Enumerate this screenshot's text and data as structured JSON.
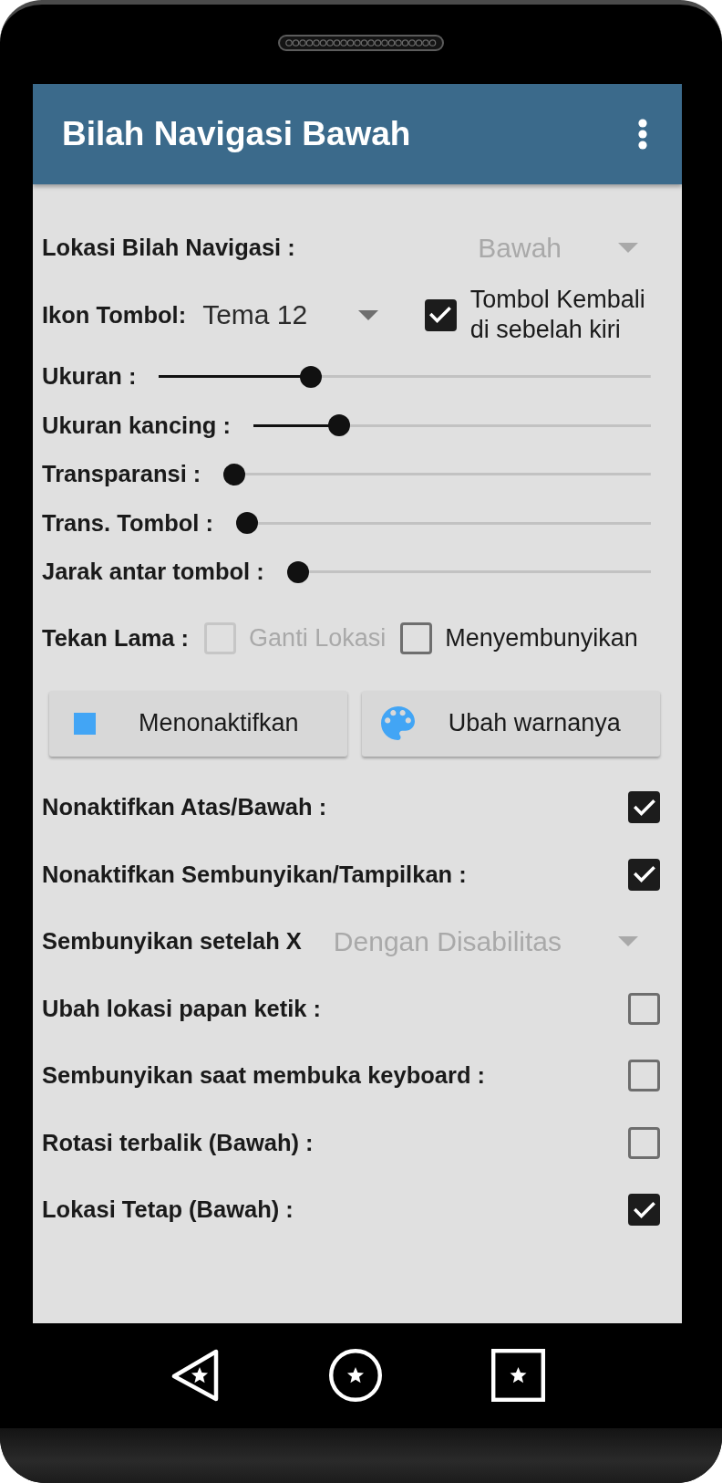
{
  "app_bar": {
    "title": "Bilah Navigasi Bawah"
  },
  "settings": [
    {
      "kind": "dropdown",
      "label": "Lokasi Bilah Navigasi :",
      "value": "Bawah",
      "disabled": true
    },
    {
      "kind": "theme",
      "label": "Ikon Tombol:",
      "value": "Tema 12",
      "disabled": false,
      "option": {
        "label": "Tombol Kembali di sebelah kiri",
        "checked": true
      }
    },
    {
      "kind": "slider",
      "label": "Ukuran :",
      "level": 0.3
    },
    {
      "kind": "slider",
      "label": "Ukuran kancing :",
      "level": 0.2
    },
    {
      "kind": "slider",
      "label": "Transparansi :",
      "level": 0
    },
    {
      "kind": "slider",
      "label": "Trans. Tombol :",
      "level": 0
    },
    {
      "kind": "slider",
      "label": "Jarak antar tombol :",
      "level": 0
    },
    {
      "kind": "options",
      "label": "Tekan Lama :",
      "options": [
        {
          "label": "Ganti Lokasi",
          "checked": false,
          "disabled": true
        },
        {
          "label": "Menyembunyikan",
          "checked": false,
          "disabled": false
        }
      ]
    },
    {
      "kind": "buttons",
      "buttons": [
        {
          "label": "Menonaktifkan"
        },
        {
          "label": "Ubah warnanya"
        }
      ]
    },
    {
      "kind": "checkbox",
      "label": "Nonaktifkan Atas/Bawah :",
      "checked": true
    },
    {
      "kind": "checkbox",
      "label": "Nonaktifkan Sembunyikan/Tampilkan :",
      "checked": true
    },
    {
      "kind": "dropdown",
      "label": "Sembunyikan setelah X",
      "value": "Dengan Disabilitas",
      "disabled": true
    },
    {
      "kind": "checkbox",
      "label": "Ubah lokasi papan ketik :",
      "checked": false
    },
    {
      "kind": "checkbox",
      "label": "Sembunyikan saat membuka keyboard :",
      "checked": false
    },
    {
      "kind": "checkbox",
      "label": "Rotasi terbalik (Bawah) :",
      "checked": false
    },
    {
      "kind": "checkbox",
      "label": "Lokasi Tetap (Bawah) :",
      "checked": true
    }
  ]
}
